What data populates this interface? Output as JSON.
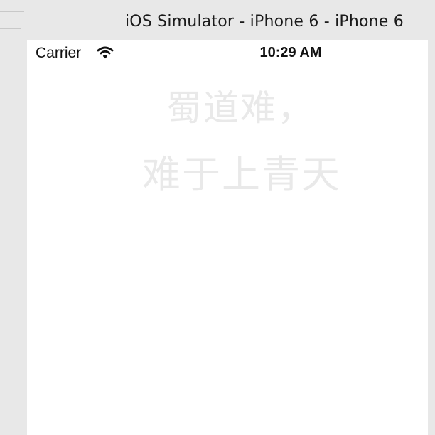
{
  "window": {
    "title": "iOS Simulator - iPhone 6 - iPhone 6"
  },
  "status_bar": {
    "carrier": "Carrier",
    "time": "10:29 AM",
    "wifi_icon": "wifi-icon"
  },
  "poem": {
    "line1": "蜀道难，",
    "line2": "难于上青天"
  },
  "colors": {
    "window_chrome": "#e8e8e8",
    "screen_background": "#ffffff",
    "status_text": "#111111",
    "poem_text": "#e9e9e9"
  }
}
